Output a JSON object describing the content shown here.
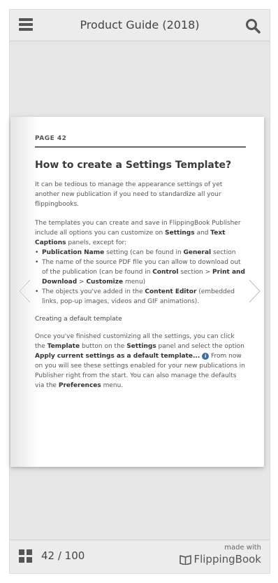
{
  "header": {
    "title": "Product Guide (2018)",
    "menu_icon": "hamburger-icon",
    "search_icon": "search-icon"
  },
  "page": {
    "label": "PAGE 42",
    "heading": "How to create a Settings Template?",
    "intro": "It can be tedious to manage the appearance settings of yet another new publication if you need to standardize all your flippingbooks.",
    "templates_para": {
      "p1": "The templates you can create and save in FlippingBook Publisher include all options you can customize on ",
      "b1": "Settings",
      "p2": " and ",
      "b2": "Text Captions",
      "p3": " panels, except for:"
    },
    "bullets": [
      {
        "b1": "Publication Name",
        "t1": " setting (can be found in ",
        "b2": "General",
        "t2": " section"
      },
      {
        "t0": "The name of the source PDF file you can allow to download out of the publication (can be found in ",
        "b1": "Control",
        "t1": " section > ",
        "b2": "Print and Download",
        "t2": " > ",
        "b3": "Customize",
        "t3": " menu)"
      },
      {
        "t0": "The objects you've added in the ",
        "b1": "Content Editor",
        "t1": " (embedded links, pop-up images, videos and GIF animations)."
      }
    ],
    "subheading": "Creating a default template",
    "closing": {
      "t0": "Once you've finished customizing all the settings, you can click the ",
      "b1": "Template",
      "t1": " button on the ",
      "b2": "Settings",
      "t2": " panel and select the option ",
      "b3": "Apply current settings as a default template...",
      "t3": " ",
      "t4": " From now on you will see these settings enabled for your new publications in Publisher right from the start. You can also manage the defaults via the ",
      "b4": "Preferences",
      "t5": " menu."
    }
  },
  "navigation": {
    "prev_icon": "chevron-left-icon",
    "next_icon": "chevron-right-icon"
  },
  "footer": {
    "page_counter": "42 / 100",
    "made_with": "made with",
    "brand": "FlippingBook",
    "grid_icon": "grid-icon"
  },
  "colors": {
    "viewer_bg": "#e6e6e6",
    "bar_bg": "#ececec",
    "icon": "#555555",
    "info_icon": "#3a6fa5"
  }
}
